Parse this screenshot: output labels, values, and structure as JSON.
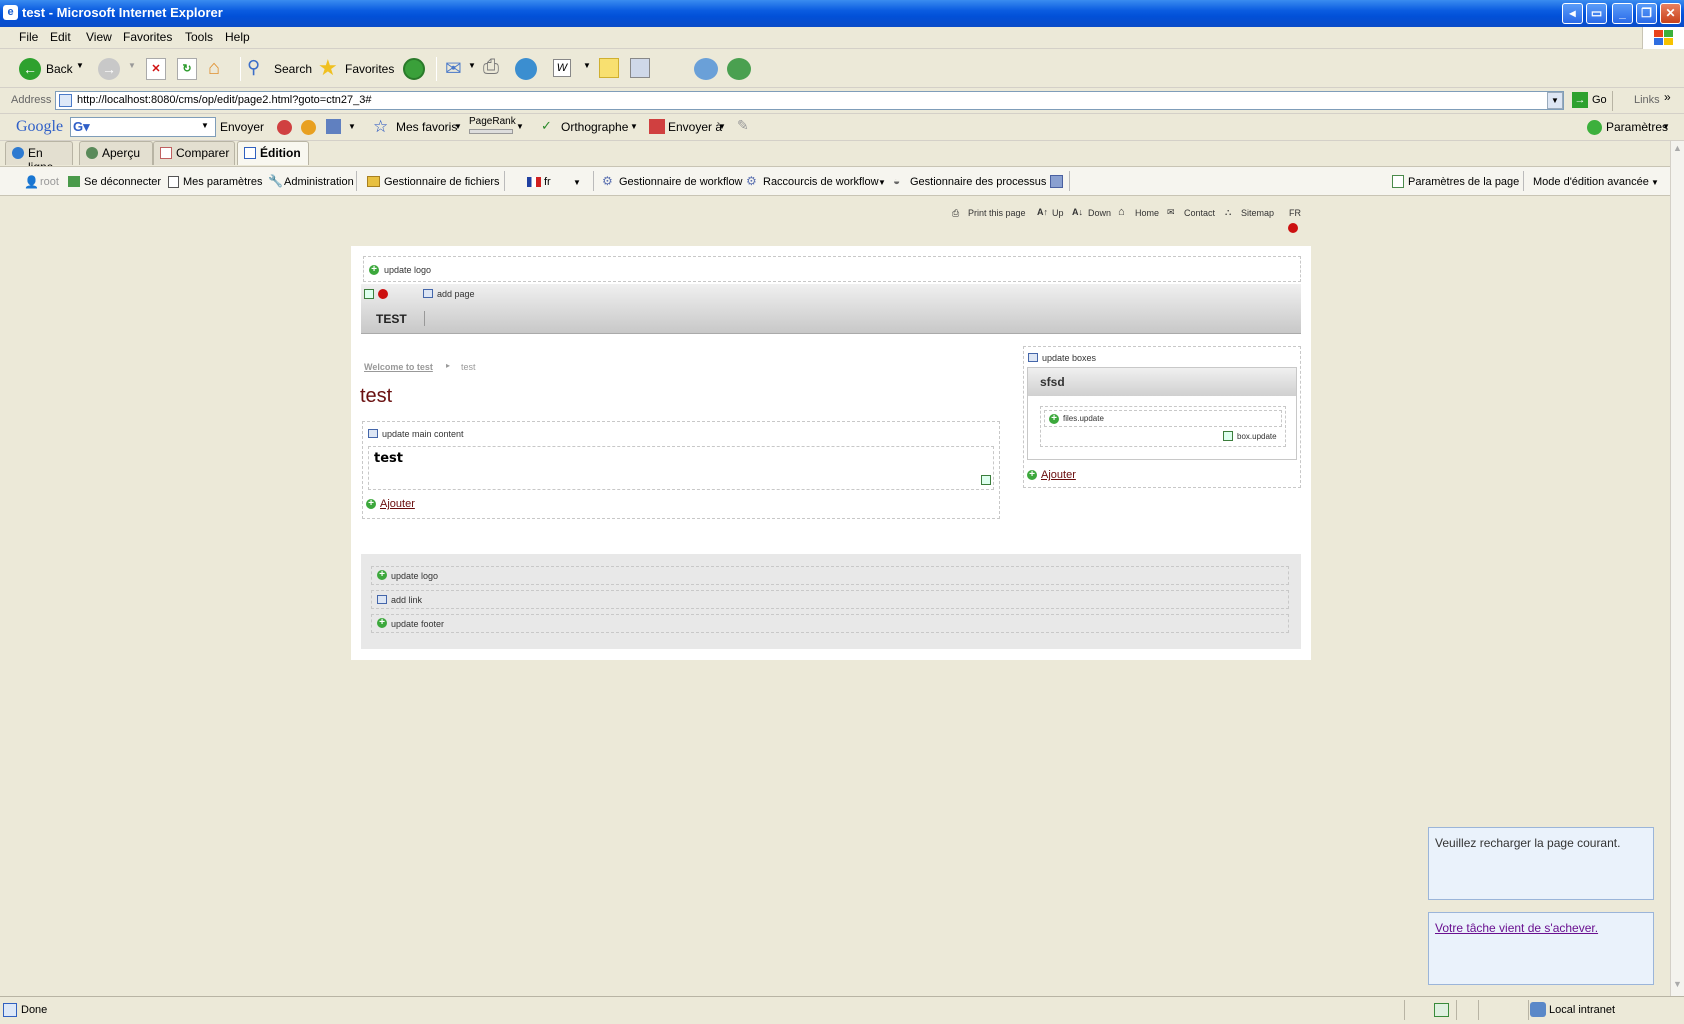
{
  "window": {
    "title": "test - Microsoft Internet Explorer"
  },
  "menu": [
    "File",
    "Edit",
    "View",
    "Favorites",
    "Tools",
    "Help"
  ],
  "toolbar": {
    "back": "Back",
    "search": "Search",
    "favorites": "Favorites"
  },
  "address": {
    "label": "Address",
    "url": "http://localhost:8080/cms/op/edit/page2.html?goto=ctn27_3#",
    "go": "Go",
    "links": "Links"
  },
  "google_bar": {
    "logo": "Google",
    "send": "Envoyer",
    "my_favorites": "Mes favoris",
    "pagerank": "PageRank",
    "spelling": "Orthographe",
    "send_to": "Envoyer à",
    "settings": "Paramètres"
  },
  "tabs": [
    "En ligne",
    "Aperçu",
    "Comparer",
    "Édition"
  ],
  "cms_toolbar": {
    "user": "root",
    "logout": "Se déconnecter",
    "my_settings": "Mes paramètres",
    "admin": "Administration",
    "file_manager": "Gestionnaire de fichiers",
    "lang": "fr",
    "workflow_manager": "Gestionnaire de workflow",
    "workflow_shortcuts": "Raccourcis de workflow",
    "process_manager": "Gestionnaire des processus",
    "page_settings": "Paramètres de la page",
    "edit_mode": "Mode d'édition avancée"
  },
  "top_links": {
    "print": "Print this page",
    "up": "Up",
    "down": "Down",
    "home": "Home",
    "contact": "Contact",
    "sitemap": "Sitemap",
    "lang": "FR"
  },
  "header": {
    "update_logo": "update logo",
    "add_page": "add page",
    "nav_item": "TEST"
  },
  "breadcrumb": {
    "home": "Welcome to test",
    "current": "test"
  },
  "main": {
    "title": "test",
    "update_main": "update main content",
    "content_title": "test",
    "add": "Ajouter"
  },
  "sidebar": {
    "update_boxes": "update boxes",
    "box_title": "sfsd",
    "files_update": "files.update",
    "box_update": "box.update",
    "add": "Ajouter"
  },
  "footer": {
    "update_logo": "update logo",
    "add_link": "add link",
    "update_footer": "update footer"
  },
  "notifications": [
    "Veuillez recharger la page courant.",
    "Votre tâche vient de s'achever."
  ],
  "status": {
    "left": "Done",
    "zone": "Local intranet"
  }
}
